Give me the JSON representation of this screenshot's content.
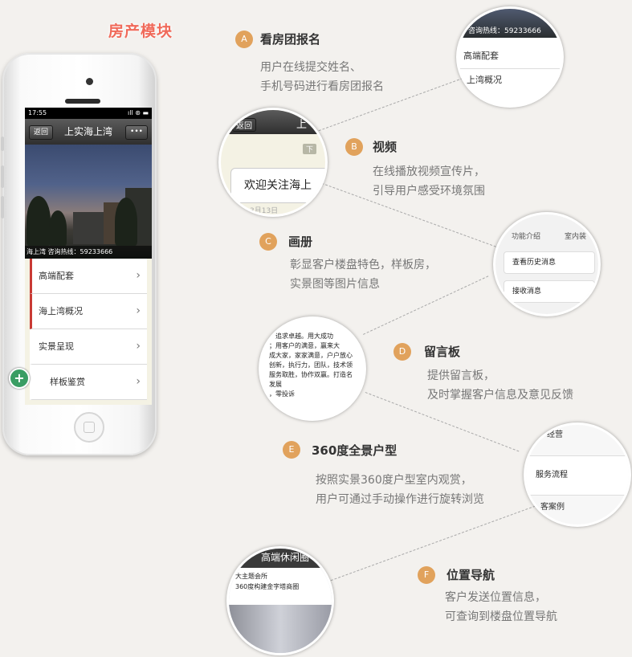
{
  "page_title": "房产模块",
  "phone": {
    "time": "17:55",
    "status_icons": "ıll ⊛ ▬",
    "nav_back": "返回",
    "nav_title": "上实海上湾",
    "nav_more": "•••",
    "banner_caption": "海上湾 咨询热线：59233666",
    "menu_items": [
      {
        "label": "高端配套"
      },
      {
        "label": "海上湾概况"
      },
      {
        "label": "实景呈现"
      },
      {
        "label": "样板鉴赏"
      }
    ],
    "fab": "+"
  },
  "features": [
    {
      "badge": "A",
      "title": "看房团报名",
      "lines": [
        "用户在线提交姓名、",
        "手机号码进行看房团报名"
      ]
    },
    {
      "badge": "B",
      "title": "视频",
      "lines": [
        "在线播放视频宣传片，",
        "引导用户感受环境氛围"
      ]
    },
    {
      "badge": "C",
      "title": "画册",
      "lines": [
        "彰显客户楼盘特色，样板房，",
        "实景图等图片信息"
      ]
    },
    {
      "badge": "D",
      "title": "留言板",
      "lines": [
        "提供留言板，",
        "及时掌握客户信息及意见反馈"
      ]
    },
    {
      "badge": "E",
      "title": "360度全景户型",
      "lines": [
        "按照实景360度户型室内观赏，",
        "用户可通过手动操作进行旋转浏览"
      ]
    },
    {
      "badge": "F",
      "title": "位置导航",
      "lines": [
        "客户发送位置信息，",
        "可查询到楼盘位置导航"
      ]
    }
  ],
  "circles": {
    "a": {
      "hotline": "咨询热线：59233666",
      "item1": "高端配套",
      "item2": "上湾概况"
    },
    "b": {
      "back": "返回",
      "title_frag": "上",
      "small_btn": "下",
      "welcome": "欢迎关注海上",
      "date": "3月13日"
    },
    "c": {
      "tab1": "功能介绍",
      "tab2": "室内装",
      "item1": "查看历史消息",
      "item2": "接收消息"
    },
    "d": {
      "lines": [
        "，追求卓越。用大成功",
        "；用客户的满意，赢来大",
        "成大家，家家满意，户户放心",
        "创新，执行力，团队，技术领",
        "服务取胜，协作双赢。打造名",
        "发展",
        "，零投诉"
      ]
    },
    "e": {
      "item1": "经营",
      "item2": "服务流程",
      "item3": "客案例"
    },
    "f": {
      "title": "高端休闲圈",
      "line1": "大主题会所",
      "line2": "360度构建金字塔商圈"
    }
  }
}
